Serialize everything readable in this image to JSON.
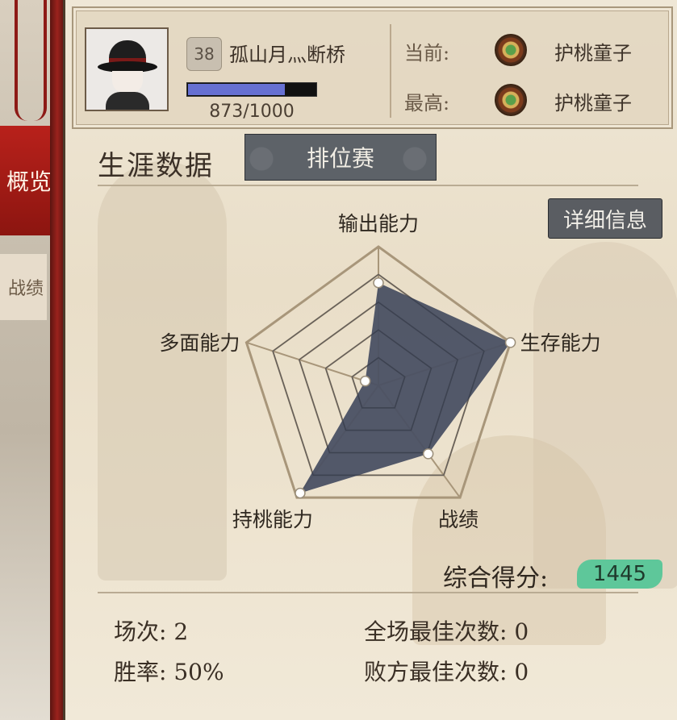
{
  "sidebar": {
    "tabs": [
      {
        "label": "概览",
        "active": true
      },
      {
        "label": "战绩",
        "active": false
      }
    ]
  },
  "profile": {
    "level": "38",
    "name": "孤山月灬断桥",
    "exp_text": "873/1000",
    "exp_progress": 0.873,
    "exp_color": "#6670d2"
  },
  "rank": {
    "current_label": "当前:",
    "current_name": "护桃童子",
    "highest_label": "最高:",
    "highest_name": "护桃童子",
    "icon": "rank-medal-icon"
  },
  "career": {
    "title": "生涯数据",
    "mode_tab": "排位赛",
    "detail_button": "详细信息"
  },
  "chart_data": {
    "type": "radar",
    "axes": [
      "输出能力",
      "生存能力",
      "战绩",
      "持桃能力",
      "多面能力"
    ],
    "values": [
      0.74,
      1.0,
      0.61,
      0.96,
      0.1
    ],
    "max": 1.0,
    "rings": 5,
    "fill_color": "#4a5063",
    "grid_color": "#a8967a"
  },
  "summary": {
    "score_label": "综合得分:",
    "score_value": "1445",
    "score_color": "#5ec79a"
  },
  "stats": {
    "matches": "场次: 2",
    "win_rate": "胜率: 50%",
    "mvp_count": "全场最佳次数: 0",
    "svp_count": "败方最佳次数: 0"
  }
}
